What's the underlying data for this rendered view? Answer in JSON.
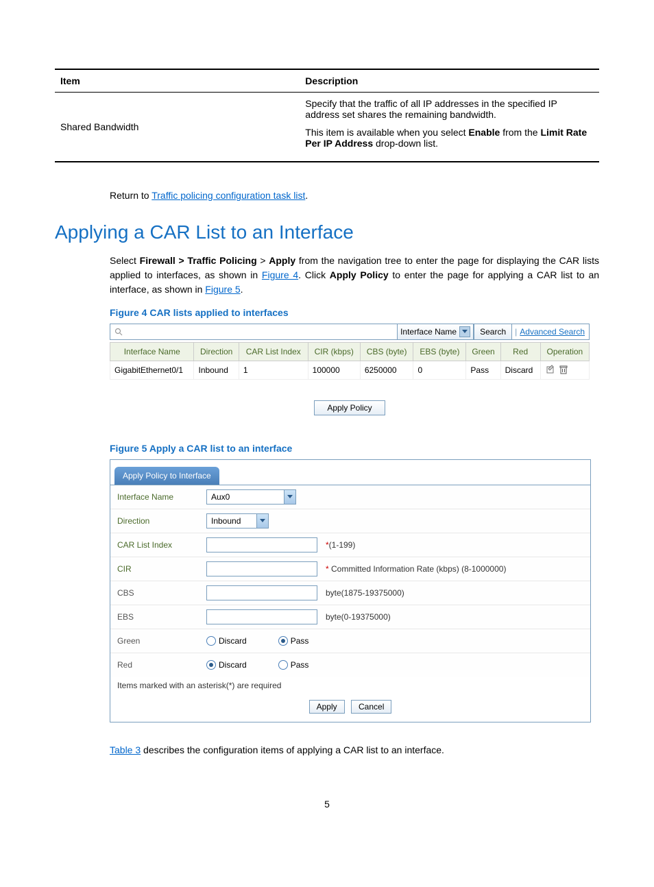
{
  "topTable": {
    "headers": [
      "Item",
      "Description"
    ],
    "row": {
      "item": "Shared Bandwidth",
      "desc1_a": "Specify that the traffic of all IP addresses in the specified IP address set shares the remaining bandwidth.",
      "desc2_a": "This item is available when you select ",
      "desc2_b": "Enable",
      "desc2_c": " from the ",
      "desc2_d": "Limit Rate Per IP Address",
      "desc2_e": " drop-down list."
    }
  },
  "returnText": "Return to ",
  "returnLink": "Traffic policing configuration task list",
  "returnDot": ".",
  "heading": "Applying a CAR List to an Interface",
  "para1_a": "Select ",
  "para1_b": "Firewall > Traffic Policing",
  "para1_c": " > ",
  "para1_d": "Apply",
  "para1_e": " from the navigation tree to enter the page for displaying the CAR lists applied to interfaces, as shown in ",
  "para1_f": "Figure 4",
  "para1_g": ". Click ",
  "para1_h": "Apply Policy",
  "para1_i": " to enter the page for applying a CAR list to an interface, as shown in ",
  "para1_j": "Figure 5",
  "para1_k": ".",
  "fig4Caption": "Figure 4 CAR lists applied to interfaces",
  "searchBar": {
    "ddLabel": "Interface Name",
    "searchBtn": "Search",
    "advLink": "Advanced Search"
  },
  "grid": {
    "headers": [
      "Interface Name",
      "Direction",
      "CAR List Index",
      "CIR (kbps)",
      "CBS (byte)",
      "EBS (byte)",
      "Green",
      "Red",
      "Operation"
    ],
    "row": [
      "GigabitEthernet0/1",
      "Inbound",
      "1",
      "100000",
      "6250000",
      "0",
      "Pass",
      "Discard"
    ]
  },
  "applyPolicyBtn": "Apply Policy",
  "fig5Caption": "Figure 5 Apply a CAR list to an interface",
  "form": {
    "tab": "Apply Policy to Interface",
    "rows": {
      "ifname": {
        "label": "Interface Name",
        "value": "Aux0"
      },
      "direction": {
        "label": "Direction",
        "value": "Inbound"
      },
      "carlist": {
        "label": "CAR List Index",
        "hint": "(1-199)"
      },
      "cir": {
        "label": "CIR",
        "hint": " Committed Information Rate (kbps) (8-1000000)"
      },
      "cbs": {
        "label": "CBS",
        "hint": "byte(1875-19375000)"
      },
      "ebs": {
        "label": "EBS",
        "hint": "byte(0-19375000)"
      },
      "green": {
        "label": "Green",
        "discard": "Discard",
        "pass": "Pass"
      },
      "red": {
        "label": "Red",
        "discard": "Discard",
        "pass": "Pass"
      }
    },
    "footer": "Items marked with an asterisk(*) are required",
    "applyBtn": "Apply",
    "cancelBtn": "Cancel"
  },
  "para2_a": "Table 3",
  "para2_b": " describes the configuration items of applying a CAR list to an interface.",
  "pageNum": "5"
}
